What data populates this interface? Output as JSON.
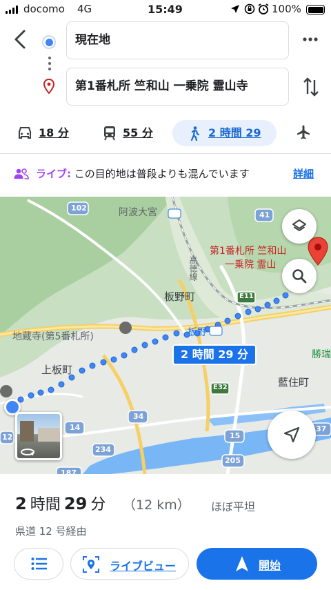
{
  "status_bar": {
    "carrier": "docomo",
    "network": "4G",
    "time": "15:49",
    "battery": "100%"
  },
  "route": {
    "origin": "現在地",
    "destination": "第1番札所 竺和山 一乗院 霊山寺"
  },
  "modes": [
    {
      "name": "car",
      "label": "18 分",
      "selected": false
    },
    {
      "name": "transit",
      "label": "55 分",
      "selected": false
    },
    {
      "name": "walk",
      "label": "2 時間 29",
      "selected": true
    }
  ],
  "live_info": {
    "label": "ライブ:",
    "text": "この目的地は普段よりも混んでいます",
    "link": "詳細"
  },
  "map": {
    "place_labels": {
      "awa_omiya": "阿波大宮",
      "itano_cho": "板野町",
      "itano": "板野",
      "jizoji": "地蔵寺(第5番札所)",
      "kamiita": "上板町",
      "aizumi": "藍住町",
      "katsuzui": "勝瑞",
      "takamatsu_line": "高徳線",
      "destination_line1": "第1番札所 竺和山",
      "destination_line2": "一乗院 霊山"
    },
    "road_labels": {
      "r102": "102",
      "r41": "41",
      "e11": "E11",
      "e32": "E32",
      "r34": "34",
      "r14": "14",
      "r12": "12",
      "r234": "234",
      "r15": "15",
      "r205": "205",
      "r37": "37",
      "r187": "187"
    },
    "duration_badge": "2 時間 29 分"
  },
  "summary": {
    "duration_num1": "2",
    "duration_unit1": "時間",
    "duration_num2": "29",
    "duration_unit2": "分",
    "distance": "（12 km）",
    "terrain": "ほぼ平坦",
    "via": "県道 12 号経由"
  },
  "actions": {
    "live_view": "ライブビュー",
    "start": "開始"
  },
  "colors": {
    "accent": "#1a73e8",
    "route_dot": "#4285f4",
    "live_purple": "#a142f4",
    "destination_red": "#c5221f"
  }
}
